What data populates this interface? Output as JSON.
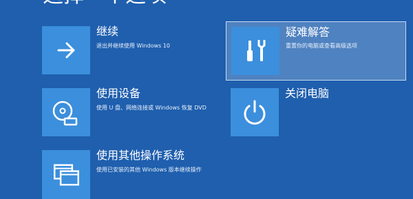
{
  "page": {
    "title": "选择一个选项"
  },
  "colors": {
    "background": "#1f5fae",
    "tile": "#3b8fdc",
    "selected_background": "#4f82c0",
    "text": "#ffffff"
  },
  "options": [
    {
      "id": "continue",
      "title": "继续",
      "description": "退出并继续使用 Windows 10",
      "icon": "arrow-right-icon"
    },
    {
      "id": "device",
      "title": "使用设备",
      "description": "使用 U 盘、网络连接或 Windows 恢复 DVD",
      "icon": "disc-drive-icon"
    },
    {
      "id": "other_os",
      "title": "使用其他操作系统",
      "description": "使用已安装的其他 Windows 版本继续操作",
      "icon": "windows-stack-icon"
    },
    {
      "id": "troubleshoot",
      "title": "疑难解答",
      "description": "重置你的电脑或查看高级选项",
      "icon": "tools-icon",
      "selected": true
    },
    {
      "id": "shutdown",
      "title": "关闭电脑",
      "description": "",
      "icon": "power-icon"
    }
  ]
}
